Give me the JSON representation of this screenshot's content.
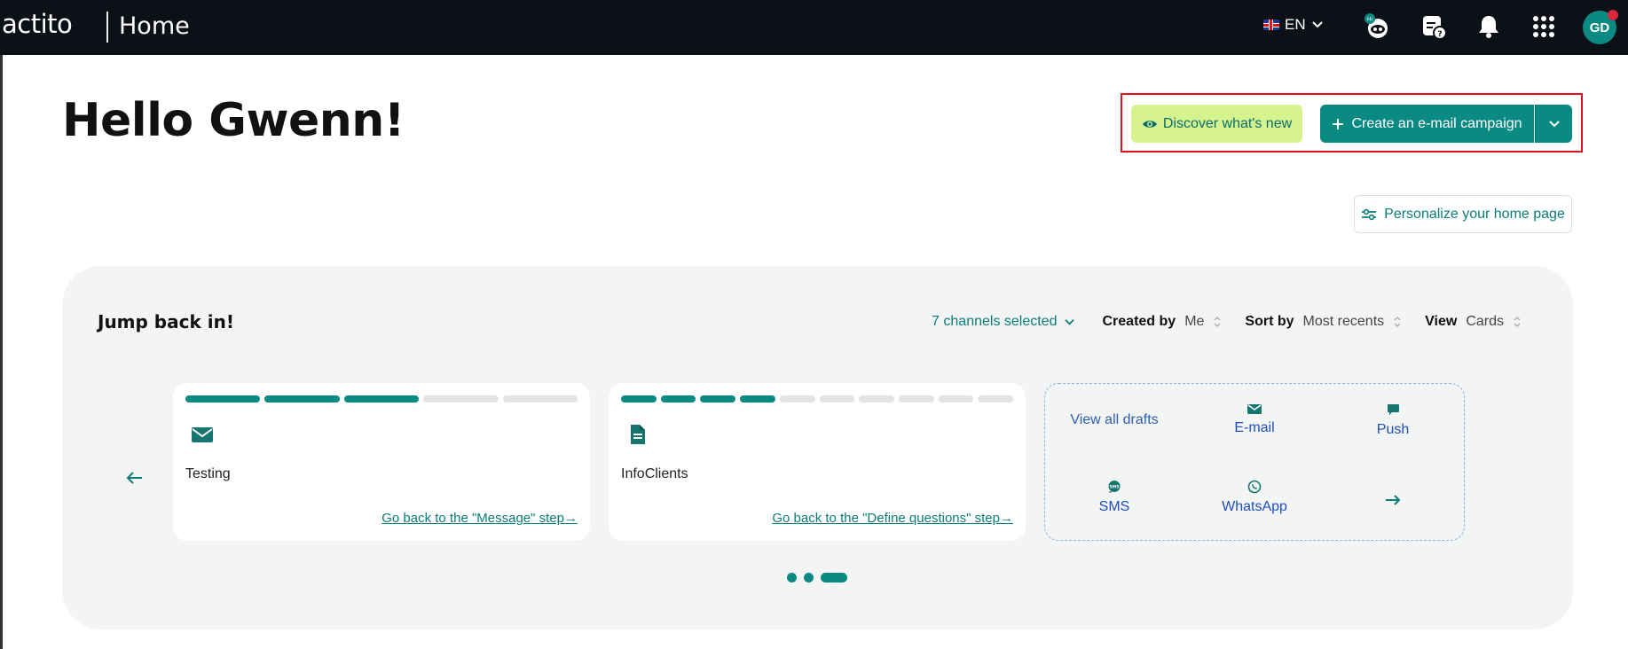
{
  "header": {
    "logo": "actito",
    "title": "Home",
    "language": "EN",
    "avatar_initials": "GD"
  },
  "greeting": "Hello Gwenn!",
  "actions": {
    "discover_label": "Discover what's new",
    "create_label": "Create an e-mail campaign",
    "personalize_label": "Personalize your home page"
  },
  "jump_back": {
    "title": "Jump back in!",
    "channels_label": "7 channels selected",
    "filters": [
      {
        "label": "Created by",
        "value": "Me"
      },
      {
        "label": "Sort by",
        "value": "Most recents"
      },
      {
        "label": "View",
        "value": "Cards"
      }
    ],
    "cards": [
      {
        "name": "Testing",
        "icon": "envelope-icon",
        "steps_total": 5,
        "steps_done": 3,
        "link": "Go back to the \"Message\" step→"
      },
      {
        "name": "InfoClients",
        "icon": "document-icon",
        "steps_total": 10,
        "steps_done": 4,
        "link": "Go back to the \"Define questions\" step→"
      }
    ],
    "drafts": {
      "view_all": "View all drafts",
      "email": "E-mail",
      "push": "Push",
      "sms": "SMS",
      "whatsapp": "WhatsApp"
    },
    "pagination": {
      "pages": 3,
      "current": 3
    }
  },
  "colors": {
    "brand": "#0b8a84",
    "topbar": "#0d1117",
    "discover_bg": "#d6f38f",
    "highlight": "#e0101e"
  }
}
